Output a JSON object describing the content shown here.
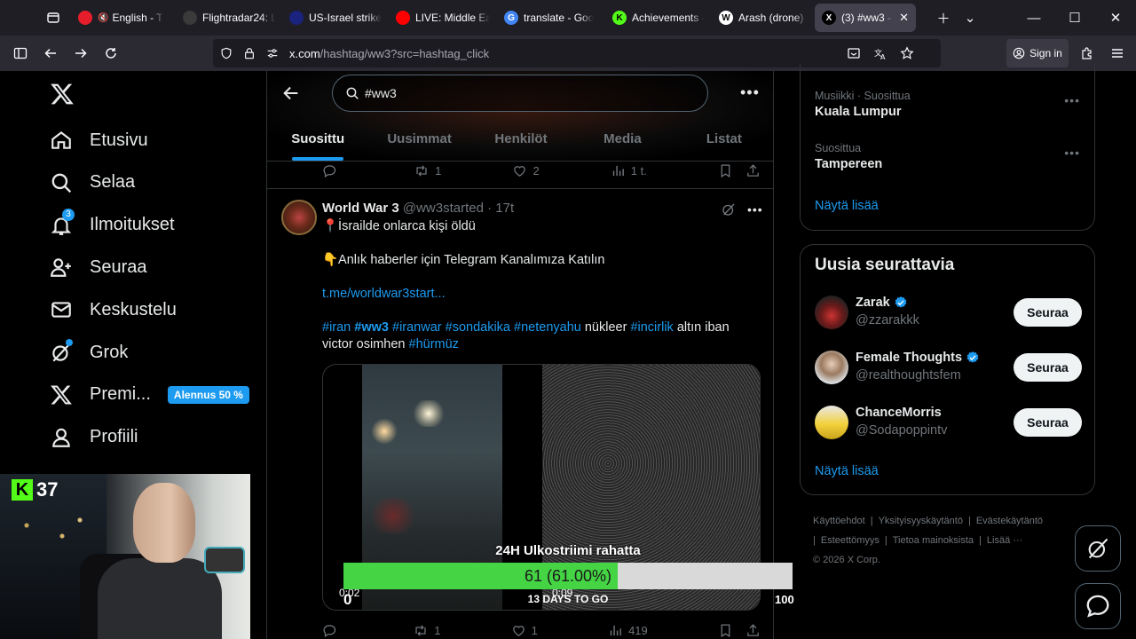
{
  "browser": {
    "tabs": [
      {
        "label": "English - T",
        "fav_color": "#e61e2b",
        "fav_text": "",
        "muted": true
      },
      {
        "label": "Flightradar24: L",
        "fav_color": "#3a3a3a",
        "fav_text": ""
      },
      {
        "label": "US-Israel strike",
        "fav_color": "#1a237e",
        "fav_text": ""
      },
      {
        "label": "LIVE: Middle Ea",
        "fav_color": "#ff0000",
        "fav_text": ""
      },
      {
        "label": "translate - Goo",
        "fav_color": "#4285f4",
        "fav_text": "G"
      },
      {
        "label": "Achievements -",
        "fav_color": "#53fc18",
        "fav_text": "K"
      },
      {
        "label": "Arash (drone) -",
        "fav_color": "#ffffff",
        "fav_text": "W"
      },
      {
        "label": "(3) #ww3 - X",
        "fav_color": "#000000",
        "fav_text": "X",
        "active": true
      }
    ],
    "url_host": "x.com",
    "url_path": "/hashtag/ww3?src=hashtag_click",
    "sign_in": "Sign in"
  },
  "nav": {
    "items": [
      {
        "label": "Etusivu",
        "icon": "home-icon"
      },
      {
        "label": "Selaa",
        "icon": "search-icon"
      },
      {
        "label": "Ilmoitukset",
        "icon": "bell-icon",
        "badge": "3"
      },
      {
        "label": "Seuraa",
        "icon": "follow-icon"
      },
      {
        "label": "Keskustelu",
        "icon": "mail-icon"
      },
      {
        "label": "Grok",
        "icon": "grok-icon"
      },
      {
        "label": "Premi...",
        "icon": "x-icon",
        "badge_text": "Alennus 50 %"
      },
      {
        "label": "Profiili",
        "icon": "profile-icon"
      }
    ]
  },
  "main": {
    "search_value": "#ww3",
    "tabs": [
      "Suosittu",
      "Uusimmat",
      "Henkilöt",
      "Media",
      "Listat"
    ],
    "prev_actions": {
      "reply": "",
      "retweet": "1",
      "like": "2",
      "views": "1 t."
    },
    "tweet": {
      "name": "World War 3",
      "handle": "@ww3started",
      "time": "· 17t",
      "line1": "📍İsrailde onlarca kişi öldü",
      "line2": "👇Anlık haberler için Telegram Kanalımıza Katılın",
      "link": "t.me/worldwar3start...",
      "tags_a": [
        "#iran",
        "#ww3",
        "#iranwar",
        "#sondakika",
        "#netenyahu"
      ],
      "text_a": "nükleer",
      "tag_b": "#incirlik",
      "text_b": "altın iban",
      "text_c": "victor osimhen",
      "tag_c": "#hürmüz",
      "video_time_1": "0:02",
      "video_time_2": "0:09",
      "actions": {
        "reply": "",
        "retweet": "1",
        "like": "1",
        "views": "419"
      }
    }
  },
  "right": {
    "trends": [
      {
        "category": "Musiikki · Suosittua",
        "title": "Kuala Lumpur"
      },
      {
        "category": "Suosittua",
        "title": "Tampereen"
      }
    ],
    "show_more": "Näytä lisää",
    "who_title": "Uusia seurattavia",
    "who": [
      {
        "name": "Zarak",
        "handle": "@zzarakkk",
        "verified": true,
        "button": "Seuraa"
      },
      {
        "name": "Female Thoughts",
        "handle": "@realthoughtsfem",
        "verified": true,
        "button": "Seuraa"
      },
      {
        "name": "ChanceMorris",
        "handle": "@Sodapoppintv",
        "verified": false,
        "button": "Seuraa"
      }
    ],
    "show_more_2": "Näytä lisää",
    "footer": [
      "Käyttöehdot",
      "|",
      "Yksityisyyskäytäntö",
      "|",
      "Evästekäytäntö",
      "|",
      "Esteettömyys",
      "|",
      "Tietoa mainoksista",
      "|",
      "Lisää ···",
      "© 2026 X Corp."
    ]
  },
  "overlay": {
    "kick_count": "37",
    "goal_title": "24H Ulkostriimi rahatta",
    "goal_value_text": "61 (61.00%)",
    "goal_fraction": 0.61,
    "goal_min": "0",
    "goal_max": "100",
    "goal_days": "13 DAYS TO GO"
  }
}
